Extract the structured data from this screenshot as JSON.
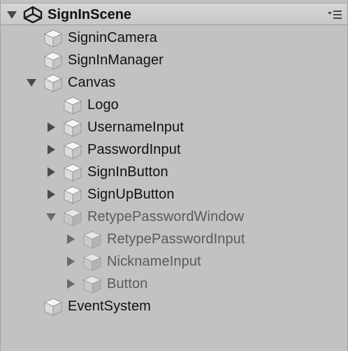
{
  "scene": {
    "name": "SignInScene",
    "expanded": true,
    "menu_icon": "options-menu-icon",
    "logo_icon": "unity-logo-icon"
  },
  "hierarchy": [
    {
      "label": "SigninCamera",
      "depth": 0,
      "arrow": "none",
      "active": true
    },
    {
      "label": "SignInManager",
      "depth": 0,
      "arrow": "none",
      "active": true
    },
    {
      "label": "Canvas",
      "depth": 0,
      "arrow": "expanded",
      "active": true
    },
    {
      "label": "Logo",
      "depth": 1,
      "arrow": "none",
      "active": true
    },
    {
      "label": "UsernameInput",
      "depth": 1,
      "arrow": "collapsed",
      "active": true
    },
    {
      "label": "PasswordInput",
      "depth": 1,
      "arrow": "collapsed",
      "active": true
    },
    {
      "label": "SignInButton",
      "depth": 1,
      "arrow": "collapsed",
      "active": true
    },
    {
      "label": "SignUpButton",
      "depth": 1,
      "arrow": "collapsed",
      "active": true
    },
    {
      "label": "RetypePasswordWindow",
      "depth": 1,
      "arrow": "expanded",
      "active": false
    },
    {
      "label": "RetypePasswordInput",
      "depth": 2,
      "arrow": "collapsed",
      "active": false
    },
    {
      "label": "NicknameInput",
      "depth": 2,
      "arrow": "collapsed",
      "active": false
    },
    {
      "label": "Button",
      "depth": 2,
      "arrow": "collapsed",
      "active": false
    },
    {
      "label": "EventSystem",
      "depth": 0,
      "arrow": "none",
      "active": true
    }
  ],
  "colors": {
    "background": "#c2c2c2",
    "text_active": "#111111",
    "text_inactive": "#5a5a5a"
  }
}
